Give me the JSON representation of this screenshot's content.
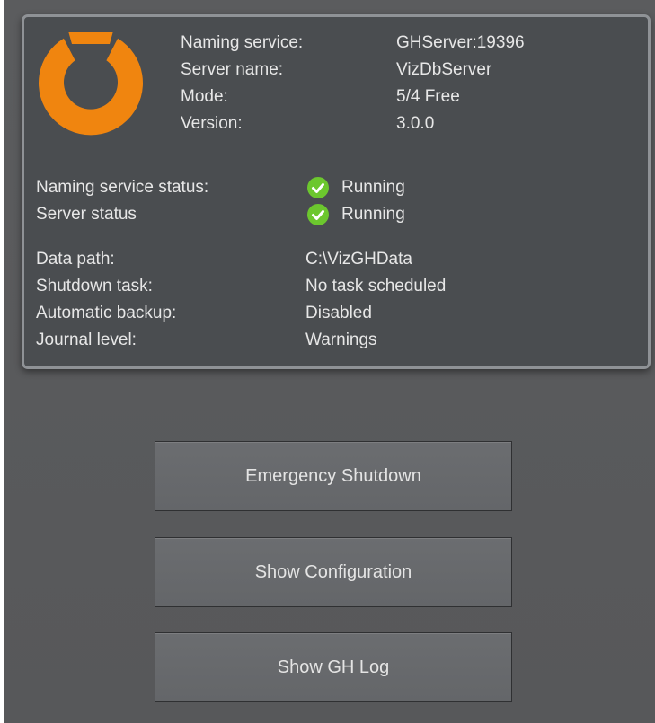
{
  "info": {
    "naming_service_label": "Naming service:",
    "naming_service_value": "GHServer:19396",
    "server_name_label": "Server name:",
    "server_name_value": "VizDbServer",
    "mode_label": "Mode:",
    "mode_value": "5/4 Free",
    "version_label": "Version:",
    "version_value": "3.0.0"
  },
  "status": {
    "naming_service_status_label": "Naming service status:",
    "naming_service_status_value": "Running",
    "server_status_label": "Server status",
    "server_status_value": "Running",
    "status_icon": "check-circle-icon",
    "status_color": "#6cc72e"
  },
  "details": {
    "data_path_label": "Data path:",
    "data_path_value": "C:\\VizGHData",
    "shutdown_task_label": "Shutdown task:",
    "shutdown_task_value": "No task scheduled",
    "automatic_backup_label": "Automatic backup:",
    "automatic_backup_value": "Disabled",
    "journal_level_label": "Journal level:",
    "journal_level_value": "Warnings"
  },
  "buttons": {
    "emergency_shutdown": "Emergency Shutdown",
    "show_configuration": "Show Configuration",
    "show_gh_log": "Show GH Log"
  },
  "colors": {
    "logo_orange": "#f0850f",
    "panel_background": "#4a4d50",
    "app_background": "#58595b"
  }
}
